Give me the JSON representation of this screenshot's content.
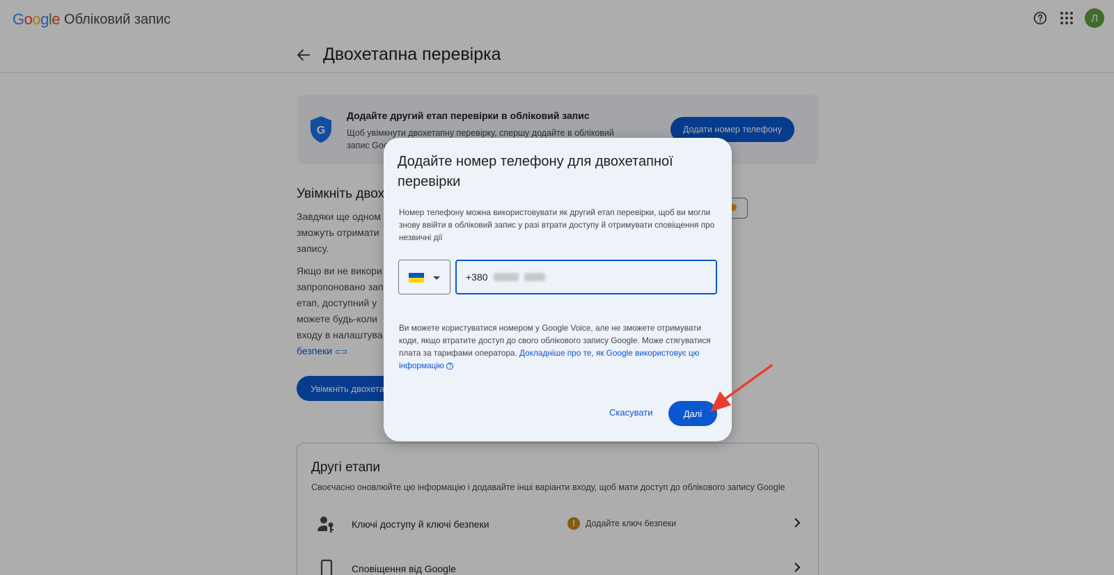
{
  "header": {
    "logo_letters": [
      "G",
      "o",
      "o",
      "g",
      "l",
      "e"
    ],
    "app_title": "Обліковий запис",
    "avatar_letter": "Л",
    "icons": [
      "help-icon",
      "apps-grid-icon"
    ]
  },
  "page": {
    "title": "Двохетапна перевірка"
  },
  "banner": {
    "title": "Додайте другий етап перевірки в обліковий запис",
    "text_line1": "Щоб увімкнути двохетапну перевірку, спершу додайте в обліковий",
    "text_line2": "запис Goog",
    "button_label": "Додати номер телефону"
  },
  "left_section": {
    "title": "Увімкніть двох",
    "p1": [
      "Завдяки ще одном",
      "зможуть отримати",
      "запису."
    ],
    "p2": [
      "Якщо ви не викори",
      "запропоновано зап",
      "етап, доступний у",
      "можете будь-коли",
      "входу в налаштува"
    ],
    "link": "безпеки",
    "button_label": "Увімкніть двохета"
  },
  "other_steps": {
    "title": "Другі етапи",
    "subtitle": "Своєчасно оновлюйте цю інформацію і додавайте інші варіанти входу, щоб мати доступ до облікового запису Google",
    "rows": [
      {
        "label": "Ключі доступу й ключі безпеки",
        "status": "Додайте ключ безпеки",
        "icon": "passkey-icon"
      },
      {
        "label": "Сповіщення від Google",
        "status": "",
        "icon": "phone-icon"
      }
    ]
  },
  "dialog": {
    "title": "Додайте номер телефону для двохетапної перевірки",
    "description": "Номер телефону можна використовувати як другий етап перевірки, щоб ви могли знову ввійти в обліковий запис у разі втрати доступу й отримувати сповіщення про незвичні дії",
    "country": "Ukraine",
    "phone_prefix": "+380",
    "note_text": "Ви можете користуватися номером у Google Voice, але не зможете отримувати коди, якщо втратите доступ до свого облікового запису Google. Може стягуватися плата за тарифами оператора. ",
    "note_link": "Докладніше про те, як Google використовує цю інформацію",
    "cancel_label": "Скасувати",
    "next_label": "Далі"
  },
  "colors": {
    "primary": "#0b57d0",
    "annotation": "#ea3d2f",
    "warning": "#c6861b"
  }
}
